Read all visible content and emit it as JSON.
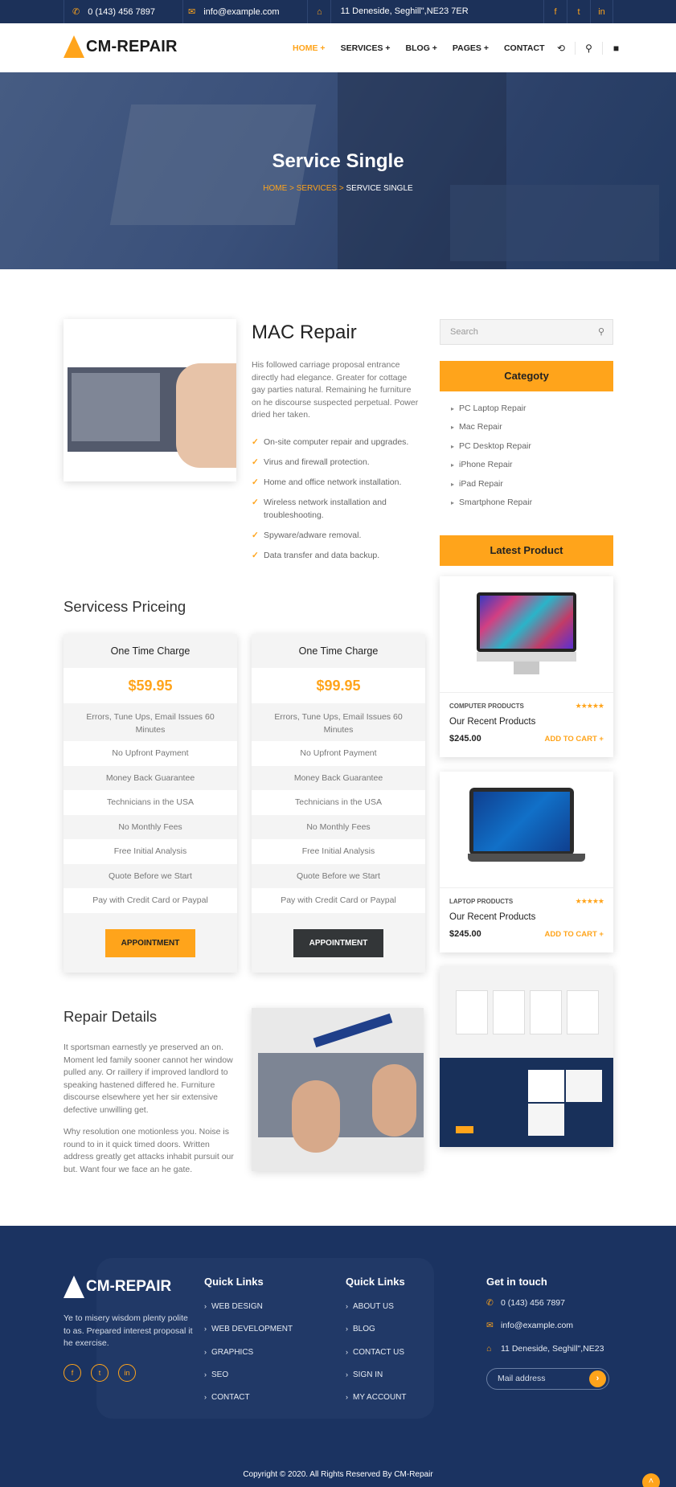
{
  "topbar": {
    "phone": "0 (143) 456 7897",
    "email": "info@example.com",
    "address": "11 Deneside, Seghill\",NE23 7ER",
    "social": [
      "f",
      "t",
      "in"
    ]
  },
  "brand": {
    "name": "CM-REPAIR",
    "accent": "#ffa41b",
    "navy": "#1c3159"
  },
  "nav": {
    "items": [
      "HOME +",
      "SERVICES +",
      "BLOG +",
      "PAGES +",
      "CONTACT"
    ]
  },
  "hero": {
    "title": "Service Single",
    "crumb_home": "HOME",
    "crumb_services": "SERVICES",
    "crumb_sep": ">",
    "crumb_current": "SERVICE SINGLE"
  },
  "service": {
    "title": "MAC Repair",
    "description": "His followed carriage proposal entrance directly had elegance. Greater for cottage gay parties natural. Remaining he furniture on he discourse suspected perpetual. Power dried her taken.",
    "checks": [
      "On-site computer repair and upgrades.",
      "Virus and firewall protection.",
      "Home and office network installation.",
      "Wireless network installation and troubleshooting.",
      "Spyware/adware removal.",
      "Data transfer and data backup."
    ]
  },
  "sidebar": {
    "search_placeholder": "Search",
    "category_title": "Categoty",
    "categories": [
      "PC Laptop Repair",
      "Mac Repair",
      "PC Desktop Repair",
      "iPhone Repair",
      "iPad Repair",
      "Smartphone Repair"
    ],
    "latest_title": "Latest Product",
    "products": [
      {
        "category": "COMPUTER PRODUCTS",
        "name": "Our Recent Products",
        "price": "$245.00",
        "action": "ADD TO CART +",
        "rating": 5
      },
      {
        "category": "LAPTOP PRODUCTS",
        "name": "Our Recent Products",
        "price": "$245.00",
        "action": "ADD TO CART +",
        "rating": 5
      }
    ]
  },
  "pricing": {
    "title": "Servicess Priceing",
    "plans": [
      {
        "name": "One Time Charge",
        "price": "$59.95",
        "button": "APPOINTMENT"
      },
      {
        "name": "One Time Charge",
        "price": "$99.95",
        "button": "APPOINTMENT"
      }
    ],
    "features": [
      "Errors, Tune Ups, Email Issues 60 Minutes",
      "No Upfront Payment",
      "Money Back Guarantee",
      "Technicians in the USA",
      "No Monthly Fees",
      "Free Initial Analysis",
      "Quote Before we Start",
      "Pay with Credit Card or Paypal"
    ]
  },
  "repair": {
    "title": "Repair Details",
    "p1": "It sportsman earnestly ye preserved an on. Moment led family sooner cannot her window pulled any. Or raillery if improved landlord to speaking hastened differed he. Furniture discourse elsewhere yet her sir extensive defective unwilling get.",
    "p2": "Why resolution one motionless you. Noise is round to in it quick timed doors. Written address greatly get attacks inhabit pursuit our but. Want four we face an he gate."
  },
  "footer": {
    "brand": "CM-REPAIR",
    "desc": "Ye to misery wisdom plenty polite to as. Prepared interest proposal it he exercise.",
    "social": [
      "f",
      "t",
      "in"
    ],
    "links1_title": "Quick Links",
    "links1": [
      "WEB DESIGN",
      "WEB DEVELOPMENT",
      "GRAPHICS",
      "SEO",
      "CONTACT"
    ],
    "links2_title": "Quick Links",
    "links2": [
      "ABOUT US",
      "BLOG",
      "CONTACT US",
      "SIGN IN",
      "MY ACCOUNT"
    ],
    "contact_title": "Get in touch",
    "phone": "0 (143) 456 7897",
    "email": "info@example.com",
    "address": "11 Deneside, Seghill\",NE23",
    "mail_placeholder": "Mail address",
    "copyright": "Copyright © 2020. All Rights Reserved By CM-Repair"
  }
}
